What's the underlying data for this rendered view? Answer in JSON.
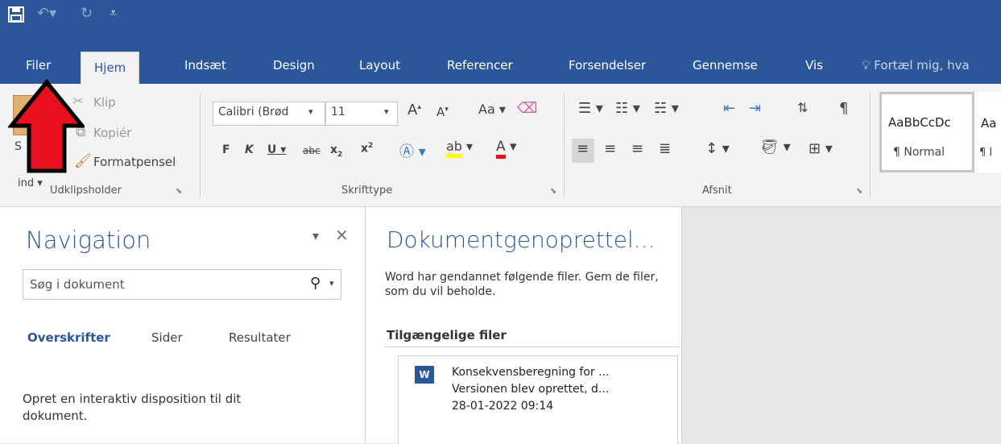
{
  "qat": {
    "save_icon": "save-icon",
    "undo_icon": "undo-icon",
    "redo_icon": "redo-icon",
    "customize_icon": "customize-icon"
  },
  "tabs": [
    "Filer",
    "Hjem",
    "Indsæt",
    "Design",
    "Layout",
    "Referencer",
    "Forsendelser",
    "Gennemse",
    "Vis"
  ],
  "tell_me": "Fortæl mig, hva",
  "clipboard": {
    "paste_label": "S",
    "paste_sub": "ind",
    "cut": "Klip",
    "copy": "Kopiér",
    "format_painter": "Formatpensel",
    "group": "Udklipsholder"
  },
  "font": {
    "font_name": "Calibri (Brød",
    "font_size": "11",
    "grow": "A",
    "shrink": "A",
    "change_case": "Aa",
    "bold": "F",
    "italic": "K",
    "underline": "U",
    "strike": "abc",
    "subscript": "x",
    "superscript": "x",
    "group": "Skrifttype"
  },
  "paragraph": {
    "group": "Afsnit"
  },
  "styles": {
    "sample": "AaBbCcDc",
    "sample2": "Aa",
    "normal": "¶ Normal",
    "next": "¶ I"
  },
  "nav": {
    "title": "Navigation",
    "search_placeholder": "Søg i dokument",
    "tabs": [
      "Overskrifter",
      "Sider",
      "Resultater"
    ],
    "hint": "Opret en interaktiv disposition til dit dokument."
  },
  "recovery": {
    "title": "Dokumentgenoprettel...",
    "desc": "Word har gendannet følgende filer. Gem de filer, som du vil beholde.",
    "available": "Tilgængelige filer",
    "file_name": "Konsekvensberegning for ...",
    "file_status": "Versionen blev oprettet, d...",
    "file_date": "28-01-2022 09:14"
  },
  "colors": {
    "brand": "#2b579a",
    "arrow": "#e8101e",
    "highlight": "#ffff00",
    "font_color": "#e81123"
  }
}
